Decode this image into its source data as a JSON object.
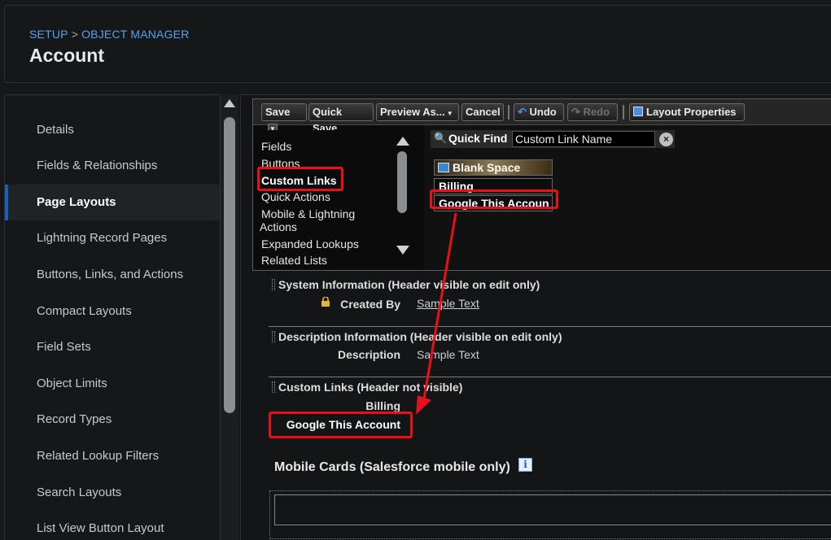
{
  "header": {
    "breadcrumb": [
      "SETUP",
      "OBJECT MANAGER"
    ],
    "breadcrumb_sep": ">",
    "title": "Account"
  },
  "sidebar": {
    "items": [
      {
        "label": "Details"
      },
      {
        "label": "Fields & Relationships"
      },
      {
        "label": "Page Layouts",
        "active": true
      },
      {
        "label": "Lightning Record Pages"
      },
      {
        "label": "Buttons, Links, and Actions"
      },
      {
        "label": "Compact Layouts"
      },
      {
        "label": "Field Sets"
      },
      {
        "label": "Object Limits"
      },
      {
        "label": "Record Types"
      },
      {
        "label": "Related Lookup Filters"
      },
      {
        "label": "Search Layouts"
      },
      {
        "label": "List View Button Layout"
      }
    ]
  },
  "toolbar": {
    "save": "Save",
    "quick_save": "Quick Save",
    "preview_as": "Preview As...",
    "cancel": "Cancel",
    "undo": "Undo",
    "redo": "Redo",
    "layout_properties": "Layout Properties"
  },
  "palette": {
    "categories": [
      "Fields",
      "Buttons",
      "Custom Links",
      "Quick Actions",
      "Mobile & Lightning",
      "Actions",
      "Expanded Lookups",
      "Related Lists"
    ],
    "quick_find_label": "Quick Find",
    "quick_find_placeholder": "Custom Link Name",
    "items": [
      "Blank Space",
      "Billing",
      "Google This Accoun"
    ]
  },
  "layout": {
    "sections": [
      {
        "title": "System Information",
        "note": "(Header visible on edit only)",
        "fields": [
          {
            "label": "Created By",
            "value": "Sample Text"
          }
        ]
      },
      {
        "title": "Description Information",
        "note": "(Header visible on edit only)",
        "fields": [
          {
            "label": "Description",
            "value": "Sample Text"
          }
        ]
      },
      {
        "title": "Custom Links",
        "note": "(Header not visible)",
        "links": [
          "Billing",
          "Google This Account"
        ]
      }
    ],
    "mobile_cards_title": "Mobile Cards (Salesforce mobile only)",
    "info_icon": "i"
  },
  "colors": {
    "accent": "#57a3ee",
    "annotation": "#e8101a",
    "active_marker": "#1b5fb8"
  }
}
